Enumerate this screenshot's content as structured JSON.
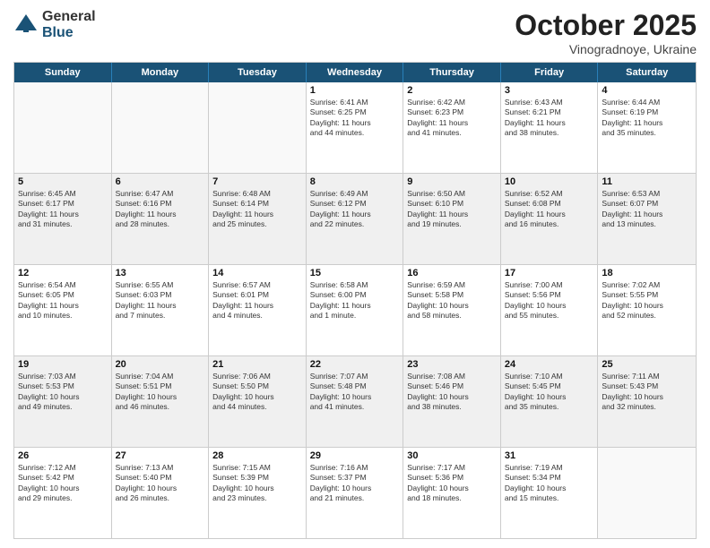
{
  "logo": {
    "general": "General",
    "blue": "Blue"
  },
  "title": "October 2025",
  "subtitle": "Vinogradnoye, Ukraine",
  "header_days": [
    "Sunday",
    "Monday",
    "Tuesday",
    "Wednesday",
    "Thursday",
    "Friday",
    "Saturday"
  ],
  "rows": [
    [
      {
        "day": "",
        "lines": []
      },
      {
        "day": "",
        "lines": []
      },
      {
        "day": "",
        "lines": []
      },
      {
        "day": "1",
        "lines": [
          "Sunrise: 6:41 AM",
          "Sunset: 6:25 PM",
          "Daylight: 11 hours",
          "and 44 minutes."
        ]
      },
      {
        "day": "2",
        "lines": [
          "Sunrise: 6:42 AM",
          "Sunset: 6:23 PM",
          "Daylight: 11 hours",
          "and 41 minutes."
        ]
      },
      {
        "day": "3",
        "lines": [
          "Sunrise: 6:43 AM",
          "Sunset: 6:21 PM",
          "Daylight: 11 hours",
          "and 38 minutes."
        ]
      },
      {
        "day": "4",
        "lines": [
          "Sunrise: 6:44 AM",
          "Sunset: 6:19 PM",
          "Daylight: 11 hours",
          "and 35 minutes."
        ]
      }
    ],
    [
      {
        "day": "5",
        "lines": [
          "Sunrise: 6:45 AM",
          "Sunset: 6:17 PM",
          "Daylight: 11 hours",
          "and 31 minutes."
        ]
      },
      {
        "day": "6",
        "lines": [
          "Sunrise: 6:47 AM",
          "Sunset: 6:16 PM",
          "Daylight: 11 hours",
          "and 28 minutes."
        ]
      },
      {
        "day": "7",
        "lines": [
          "Sunrise: 6:48 AM",
          "Sunset: 6:14 PM",
          "Daylight: 11 hours",
          "and 25 minutes."
        ]
      },
      {
        "day": "8",
        "lines": [
          "Sunrise: 6:49 AM",
          "Sunset: 6:12 PM",
          "Daylight: 11 hours",
          "and 22 minutes."
        ]
      },
      {
        "day": "9",
        "lines": [
          "Sunrise: 6:50 AM",
          "Sunset: 6:10 PM",
          "Daylight: 11 hours",
          "and 19 minutes."
        ]
      },
      {
        "day": "10",
        "lines": [
          "Sunrise: 6:52 AM",
          "Sunset: 6:08 PM",
          "Daylight: 11 hours",
          "and 16 minutes."
        ]
      },
      {
        "day": "11",
        "lines": [
          "Sunrise: 6:53 AM",
          "Sunset: 6:07 PM",
          "Daylight: 11 hours",
          "and 13 minutes."
        ]
      }
    ],
    [
      {
        "day": "12",
        "lines": [
          "Sunrise: 6:54 AM",
          "Sunset: 6:05 PM",
          "Daylight: 11 hours",
          "and 10 minutes."
        ]
      },
      {
        "day": "13",
        "lines": [
          "Sunrise: 6:55 AM",
          "Sunset: 6:03 PM",
          "Daylight: 11 hours",
          "and 7 minutes."
        ]
      },
      {
        "day": "14",
        "lines": [
          "Sunrise: 6:57 AM",
          "Sunset: 6:01 PM",
          "Daylight: 11 hours",
          "and 4 minutes."
        ]
      },
      {
        "day": "15",
        "lines": [
          "Sunrise: 6:58 AM",
          "Sunset: 6:00 PM",
          "Daylight: 11 hours",
          "and 1 minute."
        ]
      },
      {
        "day": "16",
        "lines": [
          "Sunrise: 6:59 AM",
          "Sunset: 5:58 PM",
          "Daylight: 10 hours",
          "and 58 minutes."
        ]
      },
      {
        "day": "17",
        "lines": [
          "Sunrise: 7:00 AM",
          "Sunset: 5:56 PM",
          "Daylight: 10 hours",
          "and 55 minutes."
        ]
      },
      {
        "day": "18",
        "lines": [
          "Sunrise: 7:02 AM",
          "Sunset: 5:55 PM",
          "Daylight: 10 hours",
          "and 52 minutes."
        ]
      }
    ],
    [
      {
        "day": "19",
        "lines": [
          "Sunrise: 7:03 AM",
          "Sunset: 5:53 PM",
          "Daylight: 10 hours",
          "and 49 minutes."
        ]
      },
      {
        "day": "20",
        "lines": [
          "Sunrise: 7:04 AM",
          "Sunset: 5:51 PM",
          "Daylight: 10 hours",
          "and 46 minutes."
        ]
      },
      {
        "day": "21",
        "lines": [
          "Sunrise: 7:06 AM",
          "Sunset: 5:50 PM",
          "Daylight: 10 hours",
          "and 44 minutes."
        ]
      },
      {
        "day": "22",
        "lines": [
          "Sunrise: 7:07 AM",
          "Sunset: 5:48 PM",
          "Daylight: 10 hours",
          "and 41 minutes."
        ]
      },
      {
        "day": "23",
        "lines": [
          "Sunrise: 7:08 AM",
          "Sunset: 5:46 PM",
          "Daylight: 10 hours",
          "and 38 minutes."
        ]
      },
      {
        "day": "24",
        "lines": [
          "Sunrise: 7:10 AM",
          "Sunset: 5:45 PM",
          "Daylight: 10 hours",
          "and 35 minutes."
        ]
      },
      {
        "day": "25",
        "lines": [
          "Sunrise: 7:11 AM",
          "Sunset: 5:43 PM",
          "Daylight: 10 hours",
          "and 32 minutes."
        ]
      }
    ],
    [
      {
        "day": "26",
        "lines": [
          "Sunrise: 7:12 AM",
          "Sunset: 5:42 PM",
          "Daylight: 10 hours",
          "and 29 minutes."
        ]
      },
      {
        "day": "27",
        "lines": [
          "Sunrise: 7:13 AM",
          "Sunset: 5:40 PM",
          "Daylight: 10 hours",
          "and 26 minutes."
        ]
      },
      {
        "day": "28",
        "lines": [
          "Sunrise: 7:15 AM",
          "Sunset: 5:39 PM",
          "Daylight: 10 hours",
          "and 23 minutes."
        ]
      },
      {
        "day": "29",
        "lines": [
          "Sunrise: 7:16 AM",
          "Sunset: 5:37 PM",
          "Daylight: 10 hours",
          "and 21 minutes."
        ]
      },
      {
        "day": "30",
        "lines": [
          "Sunrise: 7:17 AM",
          "Sunset: 5:36 PM",
          "Daylight: 10 hours",
          "and 18 minutes."
        ]
      },
      {
        "day": "31",
        "lines": [
          "Sunrise: 7:19 AM",
          "Sunset: 5:34 PM",
          "Daylight: 10 hours",
          "and 15 minutes."
        ]
      },
      {
        "day": "",
        "lines": []
      }
    ]
  ]
}
